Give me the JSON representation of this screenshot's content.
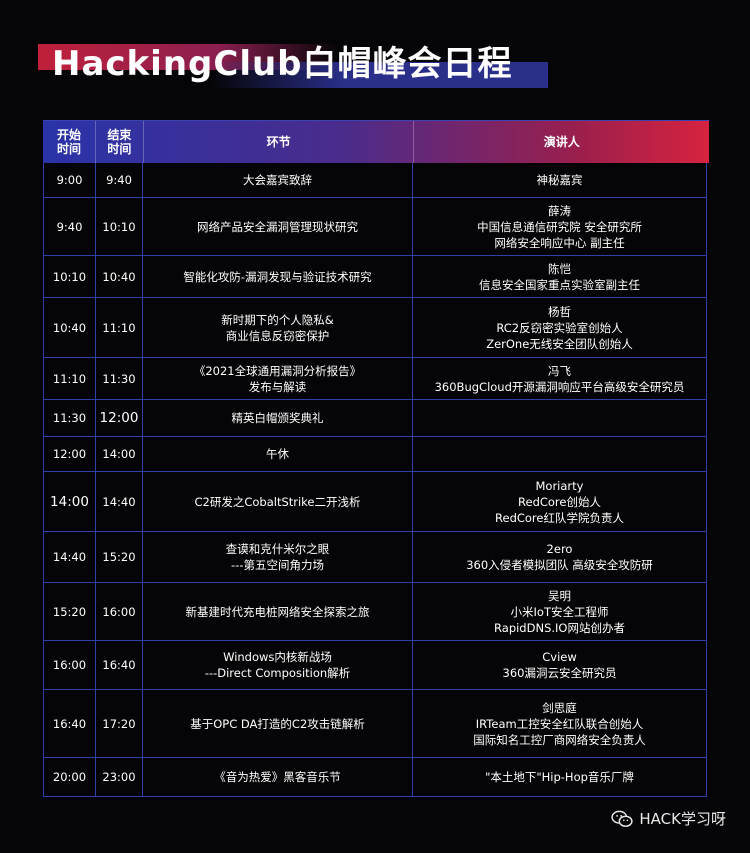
{
  "title": "HackingClub白帽峰会日程",
  "header": {
    "start": [
      "开始",
      "时间"
    ],
    "end": [
      "结束",
      "时间"
    ],
    "session": "环节",
    "speaker": "演讲人"
  },
  "rows": [
    {
      "start": "9:00",
      "end": "9:40",
      "session": [
        "大会嘉宾致辞"
      ],
      "speaker": [
        "神秘嘉宾"
      ]
    },
    {
      "start": "9:40",
      "end": "10:10",
      "session": [
        "网络产品安全漏洞管理现状研究"
      ],
      "speaker": [
        "薛涛",
        "中国信息通信研究院 安全研究所",
        "网络安全响应中心 副主任"
      ]
    },
    {
      "start": "10:10",
      "end": "10:40",
      "session": [
        "智能化攻防-漏洞发现与验证技术研究"
      ],
      "speaker": [
        "陈恺",
        "信息安全国家重点实验室副主任"
      ]
    },
    {
      "start": "10:40",
      "end": "11:10",
      "session": [
        "新时期下的个人隐私&",
        "商业信息反窃密保护"
      ],
      "speaker": [
        "杨哲",
        "RC2反窃密实验室创始人",
        "ZerOne无线安全团队创始人"
      ]
    },
    {
      "start": "11:10",
      "end": "11:30",
      "session": [
        "《2021全球通用漏洞分析报告》",
        "发布与解读"
      ],
      "speaker": [
        "冯飞",
        "360BugCloud开源漏洞响应平台高级安全研究员"
      ]
    },
    {
      "start": "11:30",
      "end": "12:00",
      "session": [
        "精英白帽颁奖典礼"
      ],
      "speaker": []
    },
    {
      "start": "12:00",
      "end": "14:00",
      "session": [
        "午休"
      ],
      "speaker": []
    },
    {
      "start": "14:00",
      "end": "14:40",
      "session": [
        "C2研发之CobaltStrike二开浅析"
      ],
      "speaker": [
        "Moriarty",
        "RedCore创始人",
        "RedCore红队学院负责人"
      ]
    },
    {
      "start": "14:40",
      "end": "15:20",
      "session": [
        "查谟和克什米尔之眼",
        "---第五空间角力场"
      ],
      "speaker": [
        "2ero",
        "360入侵者模拟团队 高级安全攻防研"
      ]
    },
    {
      "start": "15:20",
      "end": "16:00",
      "session": [
        "新基建时代充电桩网络安全探索之旅"
      ],
      "speaker": [
        "吴明",
        "小米IoT安全工程师",
        "RapidDNS.IO网站创办者"
      ]
    },
    {
      "start": "16:00",
      "end": "16:40",
      "session": [
        "Windows内核新战场",
        "---Direct Composition解析"
      ],
      "speaker": [
        "Cview",
        "360漏洞云安全研究员"
      ]
    },
    {
      "start": "16:40",
      "end": "17:20",
      "session": [
        "基于OPC DA打造的C2攻击链解析"
      ],
      "speaker": [
        "剑思庭",
        "IRTeam工控安全红队联合创始人",
        "国际知名工控厂商网络安全负责人"
      ]
    },
    {
      "start": "20:00",
      "end": "23:00",
      "session": [
        "《音为热爱》黑客音乐节"
      ],
      "speaker": [
        "\"本土地下\"Hip-Hop音乐厂牌"
      ]
    }
  ],
  "footer": {
    "account": "HACK学习呀",
    "icon": "wechat-icon"
  }
}
